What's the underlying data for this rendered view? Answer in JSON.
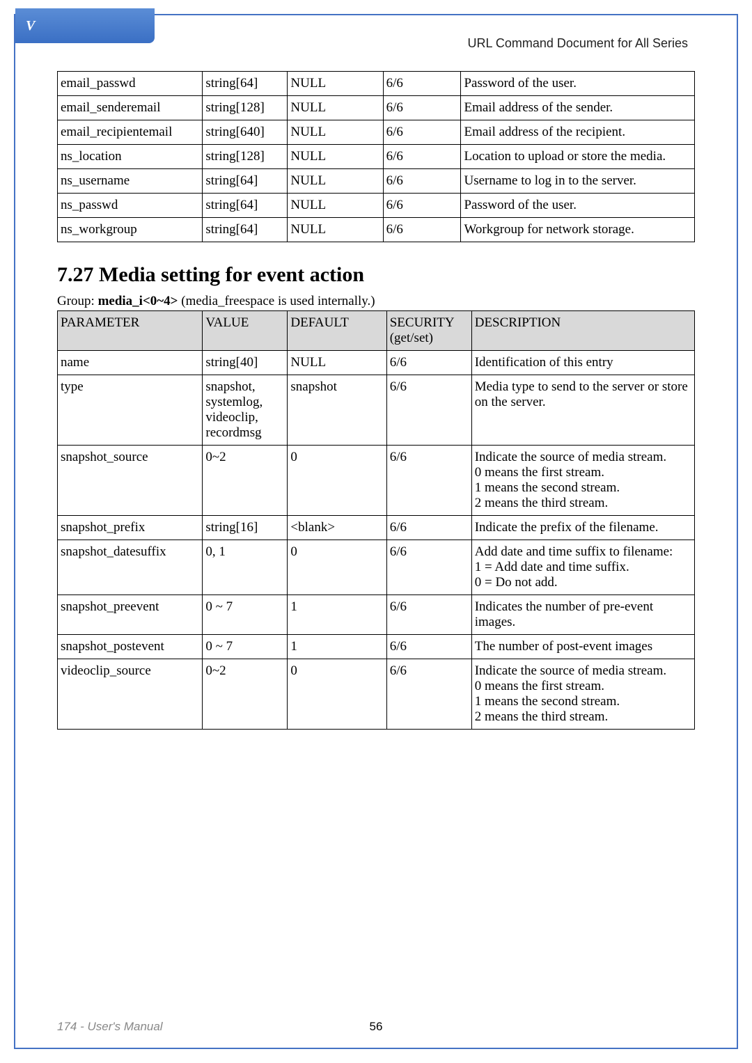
{
  "logo": "V",
  "header": "URL Command Document for All Series",
  "table1": {
    "rows": [
      {
        "param": "email_passwd",
        "value": "string[64]",
        "default": "NULL",
        "security": "6/6",
        "desc": "Password of the user."
      },
      {
        "param": "email_senderemail",
        "value": "string[128]",
        "default": "NULL",
        "security": "6/6",
        "desc": "Email address of the sender."
      },
      {
        "param": "email_recipientemail",
        "value": "string[640]",
        "default": "NULL",
        "security": "6/6",
        "desc": "Email address of the recipient."
      },
      {
        "param": "ns_location",
        "value": "string[128]",
        "default": "NULL",
        "security": "6/6",
        "desc": "Location to upload or store the media."
      },
      {
        "param": "ns_username",
        "value": "string[64]",
        "default": "NULL",
        "security": "6/6",
        "desc": "Username to log in to the server."
      },
      {
        "param": "ns_passwd",
        "value": "string[64]",
        "default": "NULL",
        "security": "6/6",
        "desc": "Password of the user."
      },
      {
        "param": "ns_workgroup",
        "value": "string[64]",
        "default": "NULL",
        "security": "6/6",
        "desc": "Workgroup for network storage."
      }
    ]
  },
  "section_title": "7.27 Media setting for event action",
  "group_prefix": "Group: ",
  "group_bold": "media_i<0~4>",
  "group_suffix": " (media_freespace is used internally.)",
  "table2": {
    "headers": {
      "param": "PARAMETER",
      "value": "VALUE",
      "default": "DEFAULT",
      "security": "SECURITY (get/set)",
      "desc": "DESCRIPTION"
    },
    "rows": [
      {
        "param": "name",
        "value": "string[40]",
        "default": "NULL",
        "security": "6/6",
        "desc": "Identification of this entry"
      },
      {
        "param": "type",
        "value": "snapshot,\nsystemlog,\nvideoclip,\nrecordmsg",
        "default": "snapshot",
        "security": "6/6",
        "desc": "Media type to send to the server or store on the server."
      },
      {
        "param": "snapshot_source",
        "value": "0~2",
        "default": "0",
        "security": "6/6",
        "desc": "Indicate the source of media stream.\n0 means the first stream.\n1 means the second stream.\n2 means the third stream."
      },
      {
        "param": "snapshot_prefix",
        "value": "string[16]",
        "default": "<blank>",
        "security": "6/6",
        "desc": "Indicate the prefix of the filename."
      },
      {
        "param": "snapshot_datesuffix",
        "value": "0, 1",
        "default": "0",
        "security": "6/6",
        "desc": "Add date and time suffix to filename:\n1 = Add date and time suffix.\n0 = Do not add."
      },
      {
        "param": "snapshot_preevent",
        "value": "0 ~ 7",
        "default": "1",
        "security": "6/6",
        "desc": "Indicates the number of pre-event images."
      },
      {
        "param": "snapshot_postevent",
        "value": "0 ~ 7",
        "default": "1",
        "security": "6/6",
        "desc": "The number of post-event images"
      },
      {
        "param": "videoclip_source",
        "value": "0~2",
        "default": "0",
        "security": "6/6",
        "desc": "Indicate the source of media stream.\n0 means the first stream.\n1 means the second stream.\n2 means the third stream."
      }
    ]
  },
  "footer": {
    "left": "174 - User's Manual",
    "center": "56"
  }
}
